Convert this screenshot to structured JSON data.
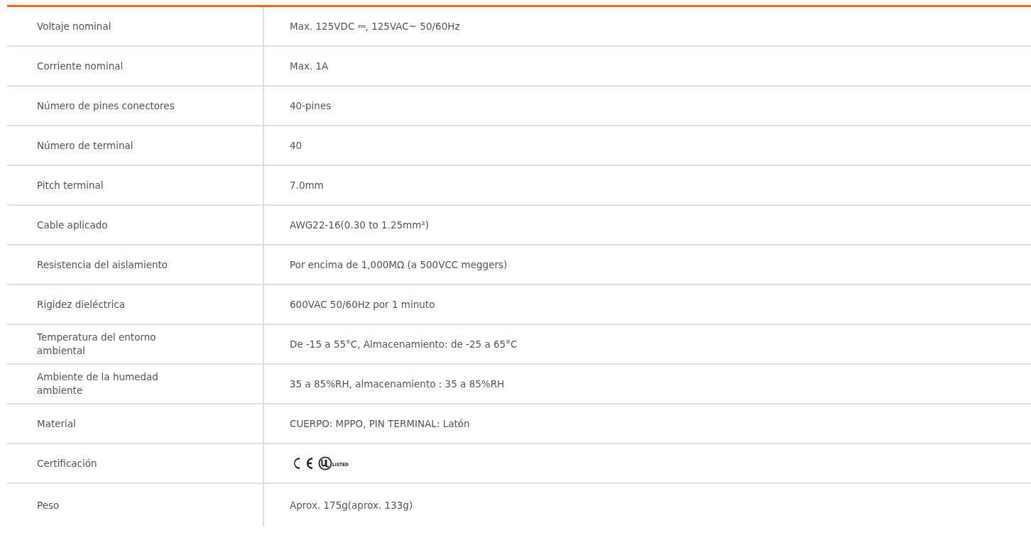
{
  "specs": [
    {
      "kind": "text",
      "label": "Voltaje nominal",
      "value": "Max. 125VDC ⎓, 125VAC~ 50/60Hz"
    },
    {
      "kind": "text",
      "label": "Corriente nominal",
      "value": "Max. 1A"
    },
    {
      "kind": "text",
      "label": "Número de pines conectores",
      "value": "40-pines"
    },
    {
      "kind": "text",
      "label": "Número de terminal",
      "value": "40"
    },
    {
      "kind": "text",
      "label": "Pitch terminal",
      "value": "7.0mm"
    },
    {
      "kind": "text",
      "label": "Cable aplicado",
      "value": "AWG22-16(0.30 to 1.25mm²)"
    },
    {
      "kind": "text",
      "label": "Resistencia del aislamiento",
      "value": "Por encima de 1,000MΩ (a 500VCC meggers)"
    },
    {
      "kind": "text",
      "label": "Rigidez dieléctrica",
      "value": "600VAC 50/60Hz por 1 minuto"
    },
    {
      "kind": "text",
      "label": "Temperatura del entorno ambiental",
      "value": "De -15 a 55°C, Almacenamiento: de -25 a 65°C"
    },
    {
      "kind": "text",
      "label": "Ambiente de la humedad ambiente",
      "value": "35 a 85%RH, almacenamiento : 35 a 85%RH"
    },
    {
      "kind": "text",
      "label": "Material",
      "value": "CUERPO: MPPO, PIN TERMINAL: Latón"
    },
    {
      "kind": "marks",
      "label": "Certificación",
      "marks": [
        {
          "kind": "ce"
        },
        {
          "kind": "ul",
          "caption": "LISTED"
        }
      ]
    },
    {
      "kind": "text",
      "label": "Peso",
      "value": "Aprox. 175g(aprox. 133g)"
    }
  ]
}
